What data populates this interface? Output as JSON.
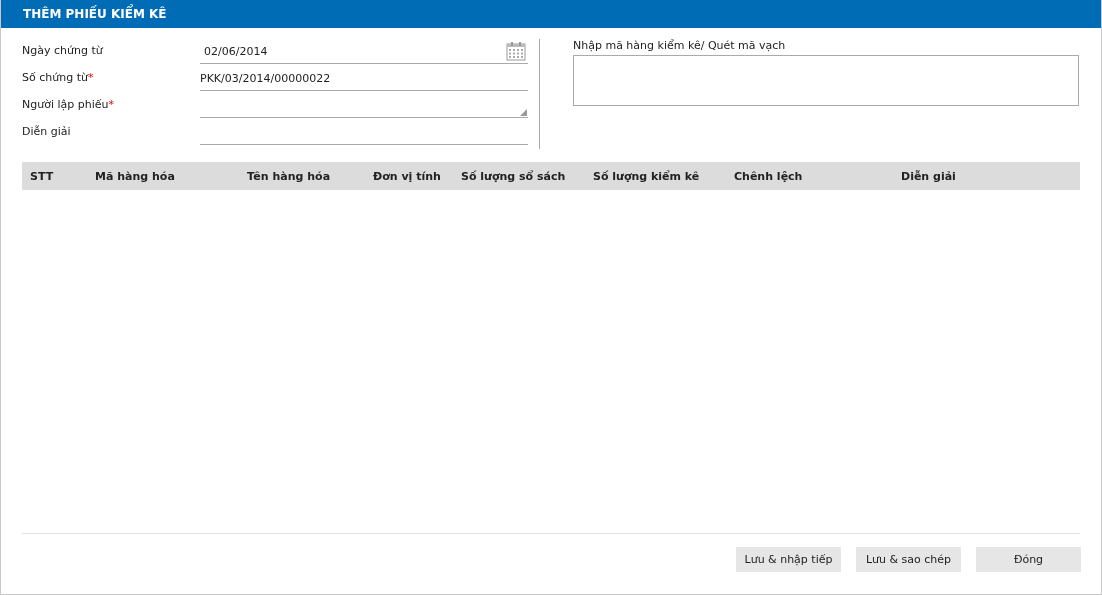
{
  "window": {
    "title": "THÊM PHIẾU KIỂM KÊ"
  },
  "fields": [
    {
      "label": "Ngày chứng từ",
      "kind": "date",
      "value": "02/06/2014"
    },
    {
      "label": "Số chứng từ",
      "required_mark": "*",
      "kind": "text",
      "value": "PKK/03/2014/00000022"
    },
    {
      "label": "Người lập phiếu",
      "required_mark": "*",
      "kind": "combo"
    },
    {
      "label": "Diễn giải",
      "kind": "text"
    }
  ],
  "scan": {
    "label": "Nhập mã hàng kiểm kê/ Quét mã vạch"
  },
  "table": {
    "columns": [
      "STT",
      "Mã hàng hóa",
      "Tên hàng hóa",
      "Đơn vị tính",
      "Số lượng sổ sách",
      "Số lượng kiểm kê",
      "Chênh lệch",
      "Diễn giải"
    ]
  },
  "buttons": [
    "Lưu & nhập tiếp",
    "Lưu & sao chép",
    "Đóng"
  ]
}
